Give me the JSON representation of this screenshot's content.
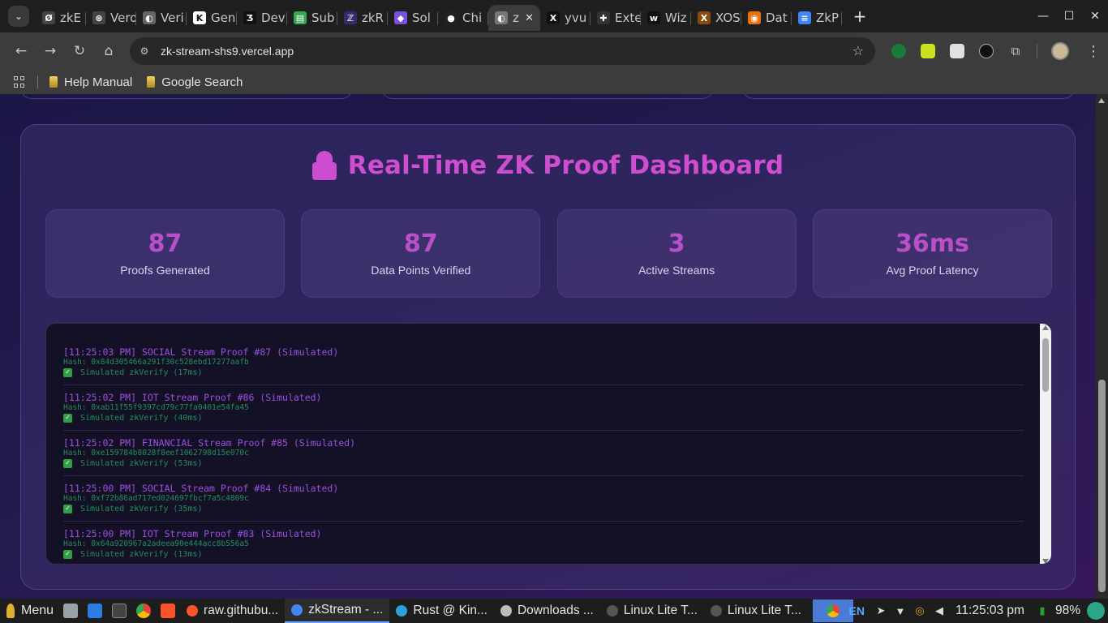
{
  "browser": {
    "tabs": [
      {
        "title": "zkE",
        "icon_color": "#444444",
        "icon_char": "Ø"
      },
      {
        "title": "Vero",
        "icon_color": "#444444",
        "icon_char": "⊛"
      },
      {
        "title": "Veri",
        "icon_color": "#666666",
        "icon_char": "◐"
      },
      {
        "title": "Gen",
        "icon_color": "#ffffff",
        "icon_char": "K"
      },
      {
        "title": "Dev",
        "icon_color": "#111111",
        "icon_char": "Ʒ"
      },
      {
        "title": "Sub",
        "icon_color": "#34a853",
        "icon_char": "▤"
      },
      {
        "title": "zkR",
        "icon_color": "#3a2a6a",
        "icon_char": "ℤ"
      },
      {
        "title": "Sol",
        "icon_color": "#7b4fe0",
        "icon_char": "◆"
      },
      {
        "title": "Chi",
        "icon_color": "#222222",
        "icon_char": "●"
      },
      {
        "title": "z",
        "icon_color": "#777777",
        "icon_char": "◐",
        "active": true
      },
      {
        "title": "yvu",
        "icon_color": "#111111",
        "icon_char": "X"
      },
      {
        "title": "Exte",
        "icon_color": "#333333",
        "icon_char": "✚"
      },
      {
        "title": "Wiz",
        "icon_color": "#111111",
        "icon_char": "w"
      },
      {
        "title": "XOS",
        "icon_color": "#8a4b10",
        "icon_char": "X"
      },
      {
        "title": "Dat",
        "icon_color": "#e8710a",
        "icon_char": "◉"
      },
      {
        "title": "ZkP",
        "icon_color": "#4285f4",
        "icon_char": "≡"
      }
    ],
    "new_tab_label": "+",
    "tab_close_label": "✕",
    "window_controls": {
      "minimize": "—",
      "maximize": "☐",
      "close": "✕"
    },
    "url": "zk-stream-shs9.vercel.app",
    "bookmarks": [
      {
        "label": "Help Manual"
      },
      {
        "label": "Google Search"
      }
    ],
    "extension_colors": [
      "#1b7a3a",
      "#c8e020",
      "#e0e0e0",
      "#111111",
      "#c7c7c7"
    ]
  },
  "dashboard": {
    "title": "Real-Time ZK Proof Dashboard",
    "stats": [
      {
        "value": "87",
        "label": "Proofs Generated"
      },
      {
        "value": "87",
        "label": "Data Points Verified"
      },
      {
        "value": "3",
        "label": "Active Streams"
      },
      {
        "value": "36ms",
        "label": "Avg Proof Latency"
      }
    ],
    "log_entries": [
      {
        "head": "[11:25:03 PM] SOCIAL Stream Proof #87 (Simulated)",
        "hash": "Hash: 0x84d305466a291f30c528ebd17277aafb",
        "status": "Simulated zkVerify (17ms)"
      },
      {
        "head": "[11:25:02 PM] IOT Stream Proof #86 (Simulated)",
        "hash": "Hash: 0xab11f55f9397cd79c77fa0401e54fa45",
        "status": "Simulated zkVerify (40ms)"
      },
      {
        "head": "[11:25:02 PM] FINANCIAL Stream Proof #85 (Simulated)",
        "hash": "Hash: 0xe159784b8028f8eef1062798d15e070c",
        "status": "Simulated zkVerify (53ms)"
      },
      {
        "head": "[11:25:00 PM] SOCIAL Stream Proof #84 (Simulated)",
        "hash": "Hash: 0xf72b86ad717ed024697fbcf7a5c4809c",
        "status": "Simulated zkVerify (35ms)"
      },
      {
        "head": "[11:25:00 PM] IOT Stream Proof #83 (Simulated)",
        "hash": "Hash: 0x64a920967a2adeea90e444acc8b556a5",
        "status": "Simulated zkVerify (13ms)"
      }
    ],
    "check_glyph": "✓"
  },
  "taskbar": {
    "menu_label": "Menu",
    "tasks": [
      {
        "label": "raw.githubu...",
        "icon_color": "#fb542b"
      },
      {
        "label": "zkStream - ...",
        "icon_color": "#4285f4",
        "active": true
      },
      {
        "label": "Rust @ Kin...",
        "icon_color": "#2aa1da"
      },
      {
        "label": "Downloads ...",
        "icon_color": "#bbbbbb"
      },
      {
        "label": "Linux Lite T...",
        "icon_color": "#555555"
      },
      {
        "label": "Linux Lite T...",
        "icon_color": "#555555"
      }
    ],
    "lang": "EN",
    "clock": "11:25:03 pm",
    "battery": "98%"
  }
}
